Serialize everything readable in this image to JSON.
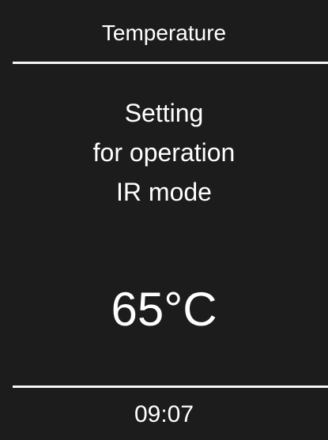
{
  "header": {
    "title": "Temperature"
  },
  "description": {
    "lines": [
      "Setting",
      "for operation",
      "IR mode"
    ]
  },
  "reading": {
    "value": "65°C"
  },
  "footer": {
    "time": "09:07"
  },
  "colors": {
    "background": "#1c1c1c",
    "text": "#ffffff",
    "divider": "#f5f5f5"
  }
}
